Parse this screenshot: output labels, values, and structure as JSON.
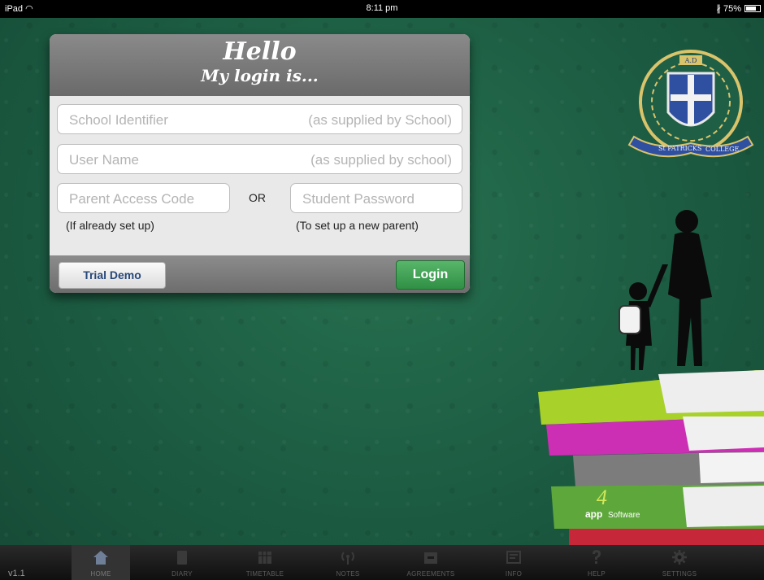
{
  "status_bar": {
    "device": "iPad",
    "time": "8:11 pm",
    "battery": "75%",
    "battery_level": 0.75
  },
  "login": {
    "greeting": "Hello",
    "subtitle": "My login is...",
    "school_identifier": {
      "placeholder": "School Identifier",
      "hint": "(as supplied by School)"
    },
    "user_name": {
      "placeholder": "User Name",
      "hint": "(as supplied by school)"
    },
    "parent_access_code": {
      "placeholder": "Parent Access Code",
      "note": "(If already set up)"
    },
    "or_label": "OR",
    "student_password": {
      "placeholder": "Student Password",
      "note": "(To set up a new parent)"
    },
    "trial_demo_label": "Trial Demo",
    "login_label": "Login"
  },
  "crest": {
    "lines": [
      "A.D",
      "St PATRICKS",
      "COLLEGE"
    ]
  },
  "brand": {
    "logo_text": "app",
    "logo_number": "4",
    "logo_sub": "Software"
  },
  "tabbar": {
    "version": "v1.1",
    "tabs": [
      {
        "label": "HOME",
        "icon": "home-icon",
        "active": true
      },
      {
        "label": "DIARY",
        "icon": "book-icon",
        "active": false
      },
      {
        "label": "TIMETABLE",
        "icon": "calendar-icon",
        "active": false
      },
      {
        "label": "NOTES",
        "icon": "broadcast-icon",
        "active": false
      },
      {
        "label": "AGREEMENTS",
        "icon": "tray-icon",
        "active": false
      },
      {
        "label": "INFO",
        "icon": "board-icon",
        "active": false
      },
      {
        "label": "HELP",
        "icon": "question-icon",
        "active": false
      },
      {
        "label": "SETTINGS",
        "icon": "gear-icon",
        "active": false
      }
    ]
  },
  "colors": {
    "background": "#1c5a43",
    "login_button": "#3d9e53",
    "tabbar": "#1a1a1a"
  }
}
